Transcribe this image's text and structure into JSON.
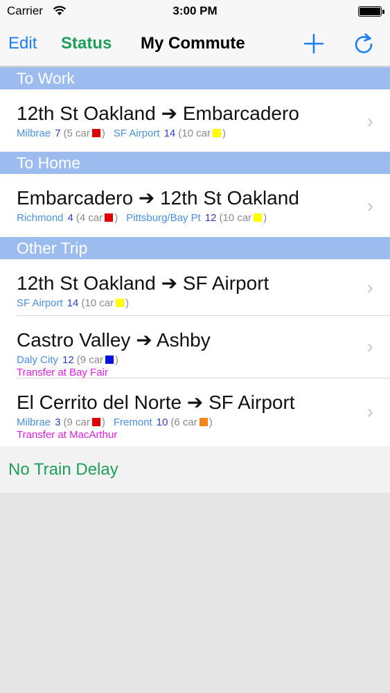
{
  "status_bar": {
    "carrier": "Carrier",
    "time": "3:00 PM"
  },
  "nav": {
    "edit": "Edit",
    "status": "Status",
    "title": "My Commute"
  },
  "sections": [
    {
      "title": "To Work",
      "trips": [
        {
          "route": "12th St Oakland ➔ Embarcadero",
          "trains": [
            {
              "dest": "Milbrae",
              "minutes": "7",
              "cars_open": "(5 car",
              "color": "#e00000",
              "close": ")"
            },
            {
              "dest": "SF Airport",
              "minutes": "14",
              "cars_open": "(10 car",
              "color": "#ffff00",
              "close": ")"
            }
          ]
        }
      ]
    },
    {
      "title": "To Home",
      "trips": [
        {
          "route": "Embarcadero ➔ 12th St Oakland",
          "trains": [
            {
              "dest": "Richmond",
              "minutes": "4",
              "cars_open": "(4 car",
              "color": "#e00000",
              "close": ")"
            },
            {
              "dest": "Pittsburg/Bay Pt",
              "minutes": "12",
              "cars_open": "(10 car",
              "color": "#ffff00",
              "close": ")"
            }
          ]
        }
      ]
    },
    {
      "title": "Other Trip",
      "trips": [
        {
          "route": "12th St Oakland ➔ SF Airport",
          "trains": [
            {
              "dest": "SF Airport",
              "minutes": "14",
              "cars_open": "(10 car",
              "color": "#ffff00",
              "close": ")"
            }
          ]
        },
        {
          "route": "Castro Valley ➔ Ashby",
          "trains": [
            {
              "dest": "Daly City",
              "minutes": "12",
              "cars_open": "(9 car",
              "color": "#0010e0",
              "close": ")"
            }
          ],
          "transfer": "Transfer at Bay Fair"
        },
        {
          "route": "El Cerrito del Norte ➔ SF Airport",
          "trains": [
            {
              "dest": "Milbrae",
              "minutes": "3",
              "cars_open": "(9 car",
              "color": "#e00000",
              "close": ")"
            },
            {
              "dest": "Fremont",
              "minutes": "10",
              "cars_open": "(6 car",
              "color": "#f5841f",
              "close": ")"
            }
          ],
          "transfer": "Transfer at MacArthur"
        }
      ]
    }
  ],
  "footer": {
    "text": "No Train Delay"
  },
  "icons": {
    "wifi": "wifi-icon",
    "battery": "battery-icon",
    "add": "plus-icon",
    "refresh": "refresh-icon",
    "chevron": "chevron-right-icon"
  },
  "colors": {
    "tint": "#1a7ef5",
    "status_green": "#1e9e5a",
    "section_header": "#9cbcf0",
    "transfer": "#e020e0"
  }
}
